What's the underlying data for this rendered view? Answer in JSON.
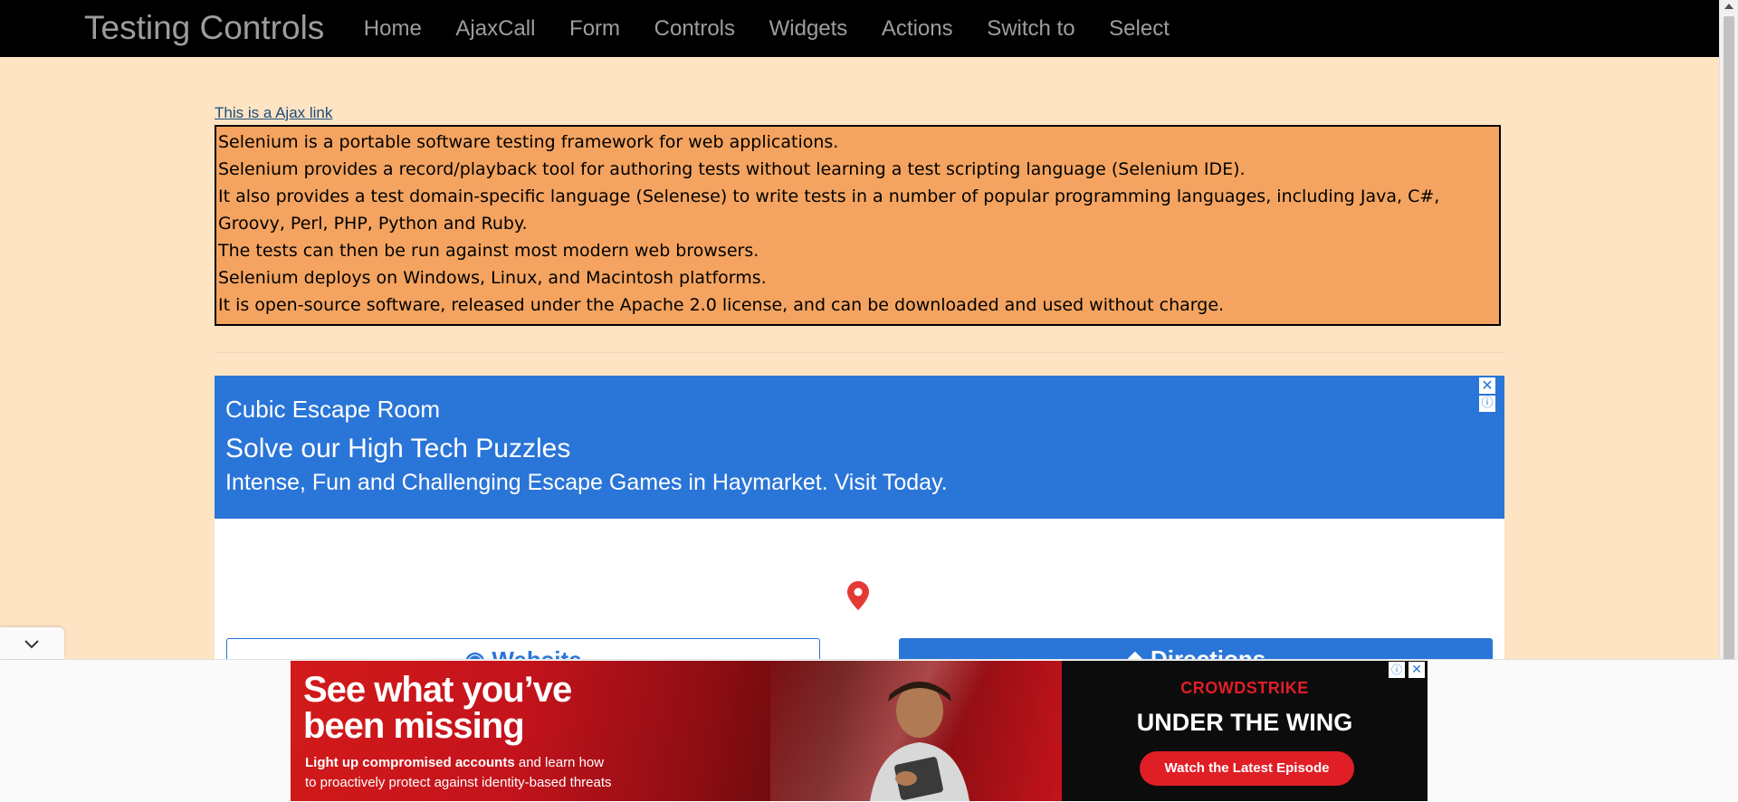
{
  "navbar": {
    "brand": "Testing Controls",
    "links": [
      "Home",
      "AjaxCall",
      "Form",
      "Controls",
      "Widgets",
      "Actions",
      "Switch to",
      "Select"
    ]
  },
  "ajax_link": "This is a Ajax link",
  "selenium_text": [
    "Selenium is a portable software testing framework for web applications.",
    "Selenium provides a record/playback tool for authoring tests without learning a test scripting language (Selenium IDE).",
    "It also provides a test domain-specific language (Selenese) to write tests in a number of popular programming languages, including Java, C#,",
    "Groovy, Perl, PHP, Python and Ruby.",
    "The tests can then be run against most modern web browsers.",
    "Selenium deploys on Windows, Linux, and Macintosh platforms.",
    "It is open-source software, released under the Apache 2.0 license, and can be downloaded and used without charge."
  ],
  "ad": {
    "advertiser": "Cubic Escape Room",
    "headline": "Solve our High Tech Puzzles",
    "description": "Intense, Fun and Challenging Escape Games in Haymarket. Visit Today.",
    "website_button": "Website",
    "directions_button": "Directions",
    "close_glyph": "✕",
    "info_glyph": "ⓘ",
    "accent_color": "#2a75d8"
  },
  "banner": {
    "headline_line1": "See what you’ve",
    "headline_line2": "been missing",
    "sub_bold": "Light up compromised accounts",
    "sub_rest": " and learn how",
    "sub_line2": "to proactively protect against identity-based threats",
    "brand": "CROWDSTRIKE",
    "title": "UNDER THE WING",
    "cta": "Watch the Latest Episode",
    "info_glyph": "ⓘ",
    "close_glyph": "✕",
    "brand_color": "#e01e26"
  },
  "colors": {
    "page_bg": "#ffe4c4",
    "navbar_bg": "#000000",
    "nav_text": "#9d9d9d",
    "selenium_box_bg": "#f4a460",
    "link_color": "#1a4d7a"
  },
  "icons": {
    "map_pin": "map-pin-icon",
    "collapse": "chevron-down-icon"
  }
}
